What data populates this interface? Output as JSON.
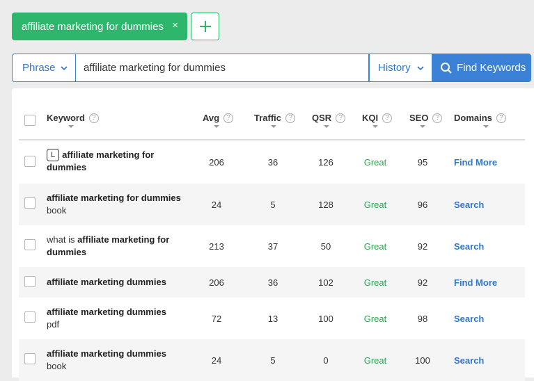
{
  "tag": {
    "label": "affiliate marketing for dummies",
    "close": "×"
  },
  "search": {
    "mode": "Phrase",
    "query": "affiliate marketing for dummies",
    "history": "History",
    "find_label": "Find Keywords"
  },
  "table": {
    "headers": {
      "keyword": "Keyword",
      "avg": "Avg",
      "traffic": "Traffic",
      "qsr": "QSR",
      "kqi": "KQI",
      "seo": "SEO",
      "domains": "Domains"
    },
    "rows": [
      {
        "badge": "L",
        "kw_pre": "",
        "kw_bold": "affiliate marketing for dummies",
        "kw_post": "",
        "avg": "206",
        "traffic": "36",
        "qsr": "126",
        "kqi": "Great",
        "seo": "95",
        "domains": "Find More"
      },
      {
        "badge": "",
        "kw_pre": "",
        "kw_bold": "affiliate marketing for dummies",
        "kw_post": " book",
        "avg": "24",
        "traffic": "5",
        "qsr": "128",
        "kqi": "Great",
        "seo": "96",
        "domains": "Search"
      },
      {
        "badge": "",
        "kw_pre": "what is ",
        "kw_bold": "affiliate marketing for dummies",
        "kw_post": "",
        "avg": "213",
        "traffic": "37",
        "qsr": "50",
        "kqi": "Great",
        "seo": "92",
        "domains": "Search"
      },
      {
        "badge": "",
        "kw_pre": "",
        "kw_bold": "affiliate marketing dummies",
        "kw_post": "",
        "avg": "206",
        "traffic": "36",
        "qsr": "102",
        "kqi": "Great",
        "seo": "92",
        "domains": "Find More"
      },
      {
        "badge": "",
        "kw_pre": "",
        "kw_bold": "affiliate marketing dummies",
        "kw_post": " pdf",
        "avg": "72",
        "traffic": "13",
        "qsr": "100",
        "kqi": "Great",
        "seo": "98",
        "domains": "Search"
      },
      {
        "badge": "",
        "kw_pre": "",
        "kw_bold": "affiliate marketing dummies",
        "kw_post": " book",
        "avg": "24",
        "traffic": "5",
        "qsr": "0",
        "kqi": "Great",
        "seo": "100",
        "domains": "Search"
      }
    ]
  },
  "colors": {
    "tag_green": "#2fb66d",
    "primary_blue": "#3b82d6",
    "great_green": "#2fa34f"
  }
}
